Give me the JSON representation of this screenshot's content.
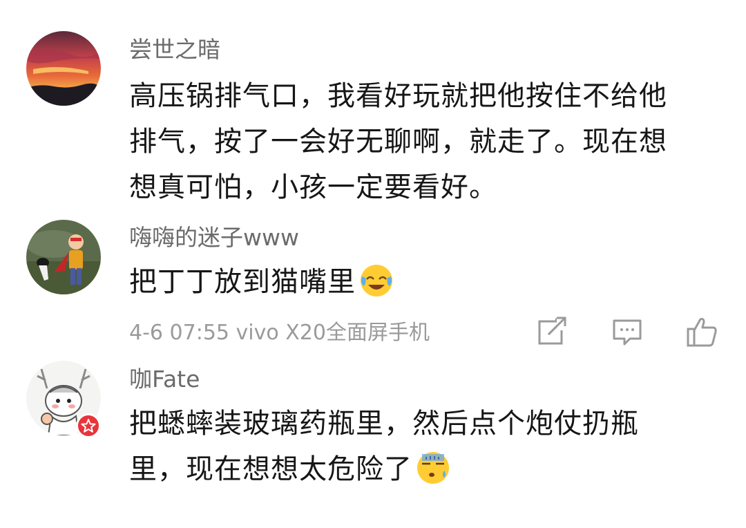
{
  "comments": [
    {
      "username": "尝世之暗",
      "lines": [
        "高压锅排气口，我看好玩就把他按住不给他",
        "排气，按了一会好无聊啊，就走了。现在想",
        "想真可怕，小孩一定要看好。"
      ]
    },
    {
      "username": "嗨嗨的迷子www",
      "text": "把丁丁放到猫嘴里",
      "emoji": "laughing-crying-emoji",
      "meta": "4-6 07:55 vivo X20全面屏手机"
    },
    {
      "username": "咖Fate",
      "lines": [
        "把蟋蟀装玻璃药瓶里，然后点个炮仗扔瓶",
        "里，现在想想太危险了"
      ],
      "emoji": "sweating-emoji"
    }
  ],
  "actions": [
    "share-icon",
    "comment-icon",
    "like-icon"
  ],
  "colors": {
    "username": "#6b6b6b",
    "meta": "#9a9a9a",
    "text": "#161616",
    "badge": "#e8343b"
  }
}
